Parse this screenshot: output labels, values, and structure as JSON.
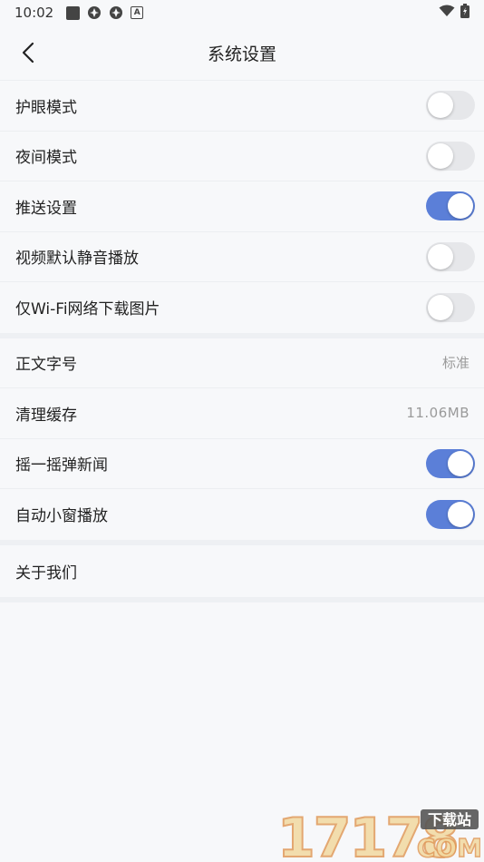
{
  "status_bar": {
    "time": "10:02",
    "notification_icons": [
      "square-icon",
      "app-icon",
      "app-icon",
      "a-icon"
    ],
    "a_icon_text": "A"
  },
  "header": {
    "title": "系统设置"
  },
  "settings": {
    "eye_care": {
      "label": "护眼模式",
      "on": false
    },
    "night_mode": {
      "label": "夜间模式",
      "on": false
    },
    "push": {
      "label": "推送设置",
      "on": true
    },
    "video_mute": {
      "label": "视频默认静音播放",
      "on": false
    },
    "wifi_images": {
      "label": "仅Wi-Fi网络下载图片",
      "on": false
    },
    "font_size": {
      "label": "正文字号",
      "value": "标准"
    },
    "clear_cache": {
      "label": "清理缓存",
      "value": "11.06MB"
    },
    "shake_news": {
      "label": "摇一摇弹新闻",
      "on": true
    },
    "mini_window": {
      "label": "自动小窗播放",
      "on": true
    },
    "about": {
      "label": "关于我们"
    }
  },
  "watermark": {
    "number": "17178",
    "tag": "下载站",
    "domain": "COM"
  },
  "colors": {
    "accent": "#5b7fd8",
    "toggle_off": "#e6e7ea",
    "background": "#f7f8fa",
    "value_text": "#9a9a9a"
  }
}
